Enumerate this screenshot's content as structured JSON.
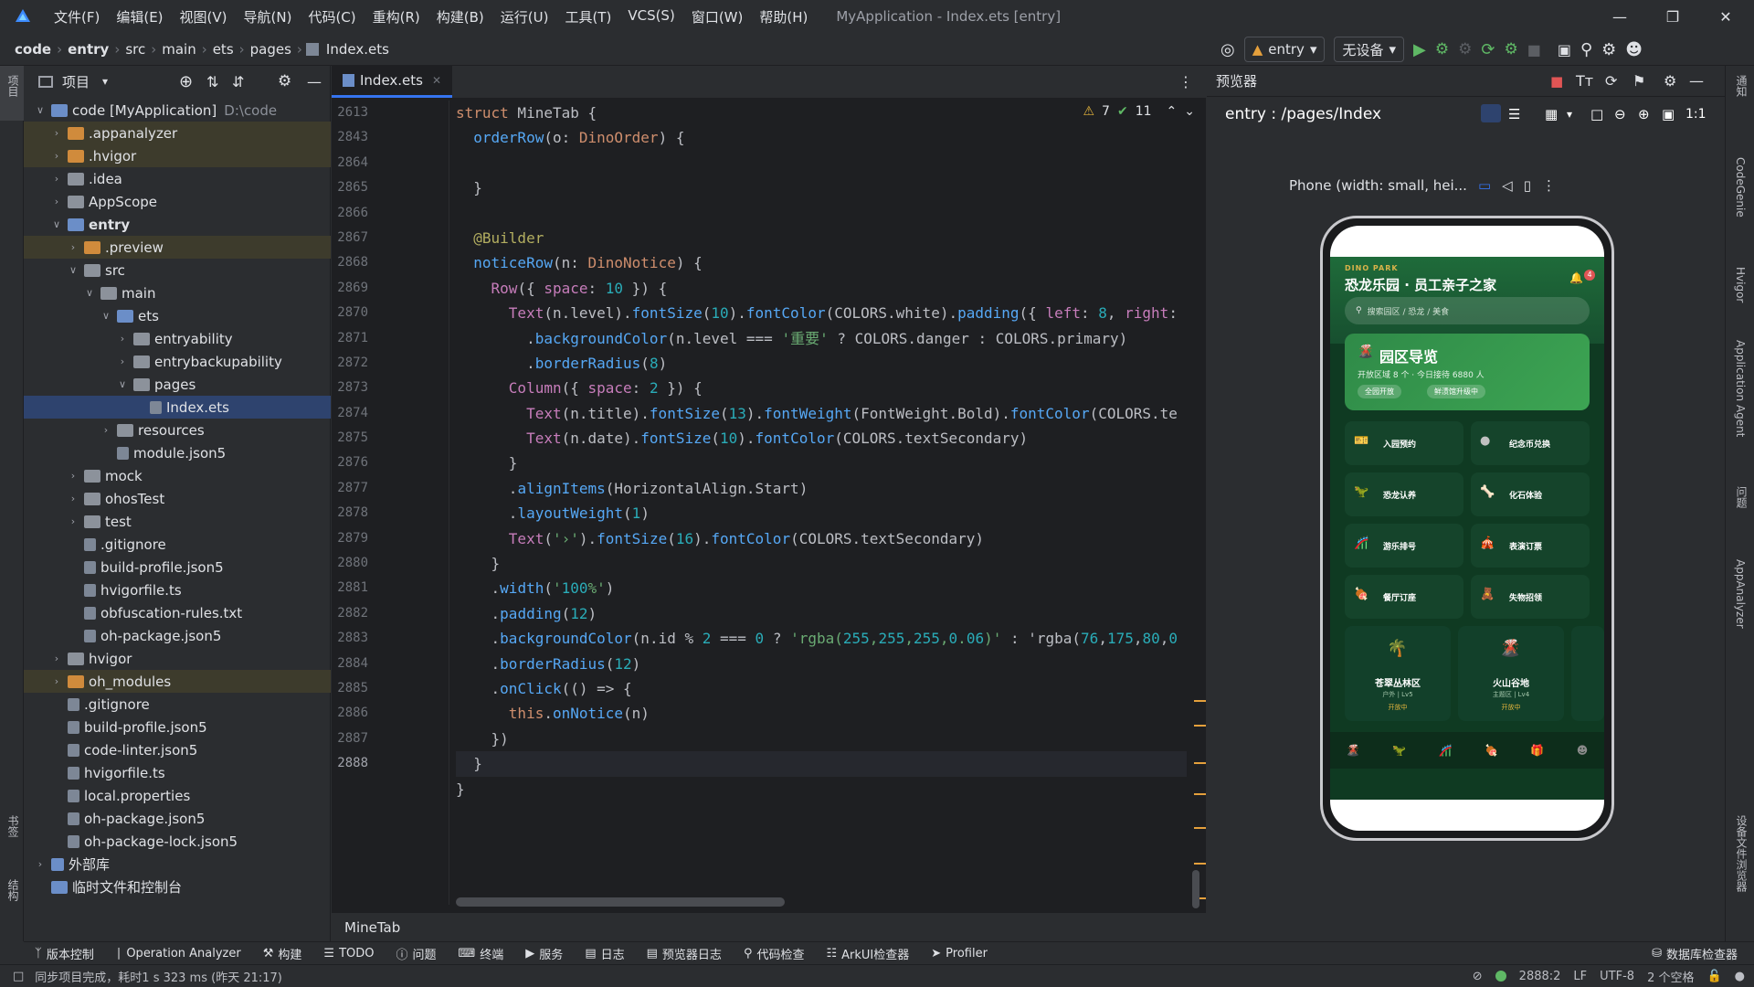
{
  "titlebar": {
    "menus": [
      "文件(F)",
      "编辑(E)",
      "视图(V)",
      "导航(N)",
      "代码(C)",
      "重构(R)",
      "构建(B)",
      "运行(U)",
      "工具(T)",
      "VCS(S)",
      "窗口(W)",
      "帮助(H)"
    ],
    "window_title": "MyApplication - Index.ets [entry]"
  },
  "navbar": {
    "breadcrumbs": [
      "code",
      "entry",
      "src",
      "main",
      "ets",
      "pages",
      "Index.ets"
    ],
    "run_config": "entry",
    "device": "无设备"
  },
  "project": {
    "header": "项目",
    "tree": [
      {
        "name": "code [MyApplication]",
        "extra": "D:\\code",
        "depth": 0,
        "arrow": "open",
        "icon": "b"
      },
      {
        "name": ".appanalyzer",
        "depth": 1,
        "arrow": "closed",
        "icon": "o",
        "excluded": true
      },
      {
        "name": ".hvigor",
        "depth": 1,
        "arrow": "closed",
        "icon": "o",
        "excluded": true
      },
      {
        "name": ".idea",
        "depth": 1,
        "arrow": "closed",
        "icon": "g"
      },
      {
        "name": "AppScope",
        "depth": 1,
        "arrow": "closed",
        "icon": "g"
      },
      {
        "name": "entry",
        "depth": 1,
        "arrow": "open",
        "icon": "b",
        "bold": true
      },
      {
        "name": ".preview",
        "depth": 2,
        "arrow": "closed",
        "icon": "o",
        "excluded": true
      },
      {
        "name": "src",
        "depth": 2,
        "arrow": "open",
        "icon": "g"
      },
      {
        "name": "main",
        "depth": 3,
        "arrow": "open",
        "icon": "g"
      },
      {
        "name": "ets",
        "depth": 4,
        "arrow": "open",
        "icon": "b"
      },
      {
        "name": "entryability",
        "depth": 5,
        "arrow": "closed",
        "icon": "g"
      },
      {
        "name": "entrybackupability",
        "depth": 5,
        "arrow": "closed",
        "icon": "g"
      },
      {
        "name": "pages",
        "depth": 5,
        "arrow": "open",
        "icon": "g"
      },
      {
        "name": "Index.ets",
        "depth": 6,
        "arrow": "none",
        "icon": "f",
        "selected": true
      },
      {
        "name": "resources",
        "depth": 4,
        "arrow": "closed",
        "icon": "g"
      },
      {
        "name": "module.json5",
        "depth": 4,
        "arrow": "none",
        "icon": "f"
      },
      {
        "name": "mock",
        "depth": 2,
        "arrow": "closed",
        "icon": "g"
      },
      {
        "name": "ohosTest",
        "depth": 2,
        "arrow": "closed",
        "icon": "g"
      },
      {
        "name": "test",
        "depth": 2,
        "arrow": "closed",
        "icon": "g"
      },
      {
        "name": ".gitignore",
        "depth": 2,
        "arrow": "none",
        "icon": "f"
      },
      {
        "name": "build-profile.json5",
        "depth": 2,
        "arrow": "none",
        "icon": "f"
      },
      {
        "name": "hvigorfile.ts",
        "depth": 2,
        "arrow": "none",
        "icon": "f"
      },
      {
        "name": "obfuscation-rules.txt",
        "depth": 2,
        "arrow": "none",
        "icon": "f"
      },
      {
        "name": "oh-package.json5",
        "depth": 2,
        "arrow": "none",
        "icon": "f"
      },
      {
        "name": "hvigor",
        "depth": 1,
        "arrow": "closed",
        "icon": "g"
      },
      {
        "name": "oh_modules",
        "depth": 1,
        "arrow": "closed",
        "icon": "o",
        "excluded": true
      },
      {
        "name": ".gitignore",
        "depth": 1,
        "arrow": "none",
        "icon": "f"
      },
      {
        "name": "build-profile.json5",
        "depth": 1,
        "arrow": "none",
        "icon": "f"
      },
      {
        "name": "code-linter.json5",
        "depth": 1,
        "arrow": "none",
        "icon": "f"
      },
      {
        "name": "hvigorfile.ts",
        "depth": 1,
        "arrow": "none",
        "icon": "f"
      },
      {
        "name": "local.properties",
        "depth": 1,
        "arrow": "none",
        "icon": "f"
      },
      {
        "name": "oh-package.json5",
        "depth": 1,
        "arrow": "none",
        "icon": "f"
      },
      {
        "name": "oh-package-lock.json5",
        "depth": 1,
        "arrow": "none",
        "icon": "f"
      },
      {
        "name": "外部库",
        "depth": 0,
        "arrow": "closed",
        "icon": "l"
      },
      {
        "name": "临时文件和控制台",
        "depth": 0,
        "arrow": "none",
        "icon": "c"
      }
    ]
  },
  "left_strip": {
    "project": "项目",
    "bookmarks": "书签",
    "structure": "结构"
  },
  "editor": {
    "tab": "Index.ets",
    "warnings": "7",
    "weak_warnings": "11",
    "footer_crumb": "MineTab",
    "line_numbers": [
      "2613",
      "2843",
      "2864",
      "2865",
      "2866",
      "2867",
      "2868",
      "2869",
      "2870",
      "2871",
      "2872",
      "2873",
      "2874",
      "2875",
      "2876",
      "2877",
      "2878",
      "2879",
      "2880",
      "2881",
      "2882",
      "2883",
      "2884",
      "2885",
      "2886",
      "2887",
      "2888"
    ],
    "code_lines": [
      "struct MineTab {",
      "  orderRow(o: DinoOrder) {",
      "",
      "  }",
      "",
      "  @Builder",
      "  noticeRow(n: DinoNotice) {",
      "    Row({ space: 10 }) {",
      "      Text(n.level).fontSize(10).fontColor(COLORS.white).padding({ left: 8, right:",
      "        .backgroundColor(n.level === '重要' ? COLORS.danger : COLORS.primary)",
      "        .borderRadius(8)",
      "      Column({ space: 2 }) {",
      "        Text(n.title).fontSize(13).fontWeight(FontWeight.Bold).fontColor(COLORS.te",
      "        Text(n.date).fontSize(10).fontColor(COLORS.textSecondary)",
      "      }",
      "      .alignItems(HorizontalAlign.Start)",
      "      .layoutWeight(1)",
      "      Text('›').fontSize(16).fontColor(COLORS.textSecondary)",
      "    }",
      "    .width('100%')",
      "    .padding(12)",
      "    .backgroundColor(n.id % 2 === 0 ? 'rgba(255,255,255,0.06)' : 'rgba(76,175,80,0",
      "    .borderRadius(12)",
      "    .onClick(() => {",
      "      this.onNotice(n)",
      "    })",
      "  }",
      "}"
    ]
  },
  "preview": {
    "title": "预览器",
    "route": "entry : /pages/Index",
    "device_label": "Phone (width: small, hei...",
    "app": {
      "brand": "DINO PARK",
      "title": "恐龙乐园 · 员工亲子之家",
      "badge": "4",
      "search_placeholder": "搜索园区 / 恐龙 / 美食",
      "guide_title": "园区导览",
      "guide_sub": "开放区域 8 个 · 今日接待 6880 人",
      "chip1": "全园开放",
      "chip2": "鲜渍馆升级中",
      "grid": [
        "入园预约",
        "纪念币兑换",
        "恐龙认养",
        "化石体验",
        "游乐排号",
        "表演订票",
        "餐厅订座",
        "失物招领"
      ],
      "zones": [
        {
          "name": "苍翠丛林区",
          "meta": "户外 | Lv5",
          "status": "开放中"
        },
        {
          "name": "火山谷地",
          "meta": "主题区 | Lv4",
          "status": "开放中"
        }
      ]
    }
  },
  "right_strip": [
    "通知",
    "CodeGenie",
    "Hvigor",
    "Application Agent",
    "问题",
    "AppAnalyzer",
    "设备文件浏览器"
  ],
  "bottom_tabs": [
    "版本控制",
    "Operation Analyzer",
    "构建",
    "TODO",
    "问题",
    "终端",
    "服务",
    "日志",
    "预览器日志",
    "代码检查",
    "ArkUI检查器",
    "Profiler",
    "数据库检查器"
  ],
  "status": {
    "message": "同步项目完成，耗时1 s 323 ms (昨天 21:17)",
    "position": "2888:2",
    "line_sep": "LF",
    "encoding": "UTF-8",
    "indent": "2 个空格"
  }
}
